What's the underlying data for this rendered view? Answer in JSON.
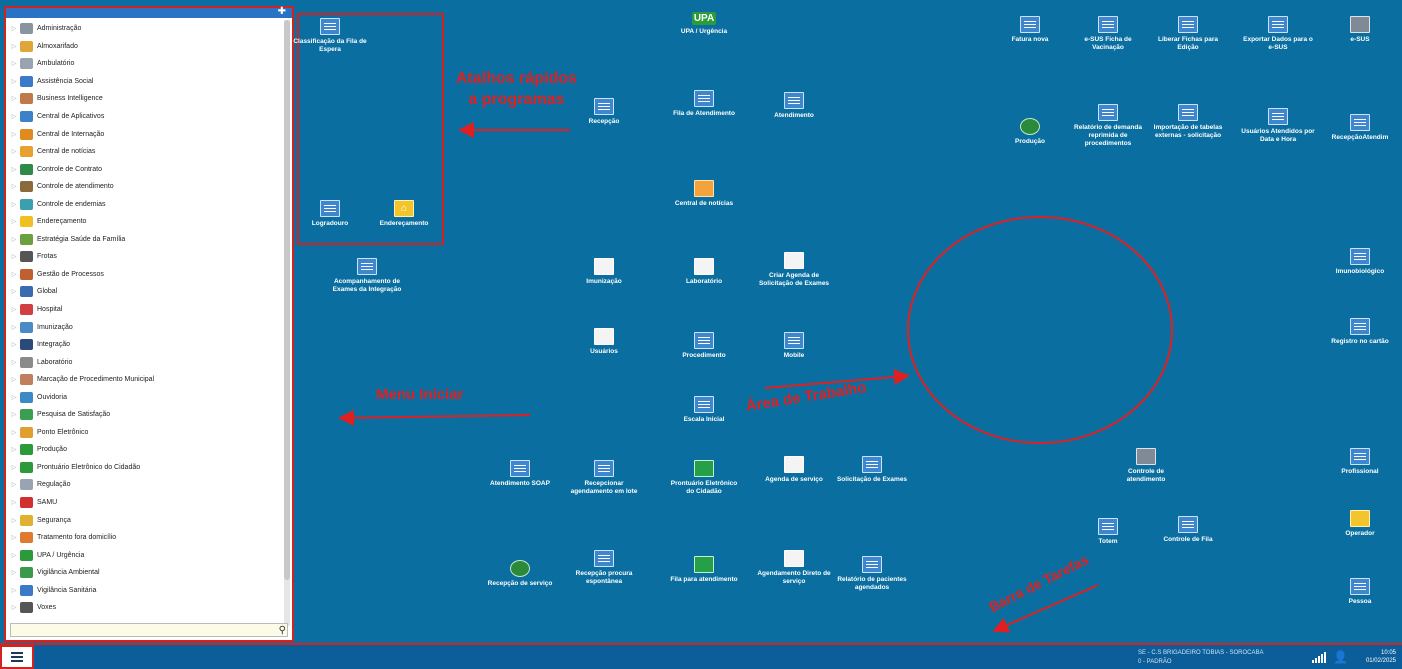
{
  "start_menu": {
    "items": [
      {
        "label": "Administração",
        "color": "#8a94a0"
      },
      {
        "label": "Almoxarifado",
        "color": "#e0a63a"
      },
      {
        "label": "Ambulatório",
        "color": "#9aa4b0"
      },
      {
        "label": "Assistência Social",
        "color": "#3b7ac8"
      },
      {
        "label": "Business Intelligence",
        "color": "#c07a4a"
      },
      {
        "label": "Central de Aplicativos",
        "color": "#3b82c8"
      },
      {
        "label": "Central de Internação",
        "color": "#e08a20"
      },
      {
        "label": "Central de notícias",
        "color": "#e8a030"
      },
      {
        "label": "Controle de Contrato",
        "color": "#2f8a4a"
      },
      {
        "label": "Controle de atendimento",
        "color": "#8a6a3a"
      },
      {
        "label": "Controle de endemias",
        "color": "#3aa0b0"
      },
      {
        "label": "Endereçamento",
        "color": "#f0c020"
      },
      {
        "label": "Estratégia Saúde da Família",
        "color": "#6aa040"
      },
      {
        "label": "Frotas",
        "color": "#555555"
      },
      {
        "label": "Gestão de Processos",
        "color": "#c06030"
      },
      {
        "label": "Global",
        "color": "#3a6ab0"
      },
      {
        "label": "Hospital",
        "color": "#d04040"
      },
      {
        "label": "Imunização",
        "color": "#4a8ac8"
      },
      {
        "label": "Integração",
        "color": "#2a4a7a"
      },
      {
        "label": "Laboratório",
        "color": "#8a8a8a"
      },
      {
        "label": "Marcação de Procedimento Municipal",
        "color": "#c08060"
      },
      {
        "label": "Ouvidoria",
        "color": "#3a8ac8"
      },
      {
        "label": "Pesquisa de Satisfação",
        "color": "#3aa050"
      },
      {
        "label": "Ponto Eletrônico",
        "color": "#e0a030"
      },
      {
        "label": "Produção",
        "color": "#2a9a3a"
      },
      {
        "label": "Prontuário Eletrônico do Cidadão",
        "color": "#2a9a3a"
      },
      {
        "label": "Regulação",
        "color": "#9aa4b0"
      },
      {
        "label": "SAMU",
        "color": "#d03030"
      },
      {
        "label": "Segurança",
        "color": "#e0b030"
      },
      {
        "label": "Tratamento fora domicílio",
        "color": "#e07a30"
      },
      {
        "label": "UPA / Urgência",
        "color": "#2a9a3a"
      },
      {
        "label": "Vigilância Ambiental",
        "color": "#3a9a4a"
      },
      {
        "label": "Vigilância Sanitária",
        "color": "#3a7ac8"
      },
      {
        "label": "Voxes",
        "color": "#555555"
      }
    ]
  },
  "quick_shortcuts": [
    {
      "label": "Classificação da Fila de Espera"
    },
    {
      "label": "Logradouro"
    },
    {
      "label": "Endereçamento"
    }
  ],
  "desktop_icons": [
    {
      "label": "UPA / Urgência"
    },
    {
      "label": "Recepção"
    },
    {
      "label": "Fila de Atendimento"
    },
    {
      "label": "Atendimento"
    },
    {
      "label": "Central de notícias"
    },
    {
      "label": "Acompanhamento de Exames da Integração"
    },
    {
      "label": "Imunização"
    },
    {
      "label": "Laboratório"
    },
    {
      "label": "Criar Agenda de Solicitação de Exames"
    },
    {
      "label": "Usuários"
    },
    {
      "label": "Procedimento"
    },
    {
      "label": "Mobile"
    },
    {
      "label": "Escala Inicial"
    },
    {
      "label": "Atendimento SOAP"
    },
    {
      "label": "Recepcionar agendamento em lote"
    },
    {
      "label": "Prontuário Eletrônico do Cidadão"
    },
    {
      "label": "Agenda de serviço"
    },
    {
      "label": "Solicitação de Exames"
    },
    {
      "label": "Recepção de serviço"
    },
    {
      "label": "Recepção procura espontânea"
    },
    {
      "label": "Fila para atendimento"
    },
    {
      "label": "Agendamento Direto de serviço"
    },
    {
      "label": "Relatório de pacientes agendados"
    },
    {
      "label": "Fatura nova"
    },
    {
      "label": "e-SUS Ficha de Vacinação"
    },
    {
      "label": "Liberar Fichas para Edição"
    },
    {
      "label": "Exportar Dados para o e-SUS"
    },
    {
      "label": "e-SUS"
    },
    {
      "label": "Produção"
    },
    {
      "label": "Relatório de demanda reprimida de procedimentos"
    },
    {
      "label": "Importação de tabelas externas - solicitação"
    },
    {
      "label": "Usuários Atendidos por Data e Hora"
    },
    {
      "label": "RecepçãoAtendim"
    },
    {
      "label": "Imunobiológico"
    },
    {
      "label": "Registro no cartão"
    },
    {
      "label": "Controle de atendimento"
    },
    {
      "label": "Totem"
    },
    {
      "label": "Controle de Fila"
    },
    {
      "label": "Profissional"
    },
    {
      "label": "Operador"
    },
    {
      "label": "Pessoa"
    }
  ],
  "annotations": {
    "atalhos_line1": "Atalhos rápidos",
    "atalhos_line2": "a programas",
    "menu": "Menu Iniciar",
    "area": "Área de Trabalho",
    "barra": "Barra de Tarefas"
  },
  "taskbar": {
    "status_line1": "SE - C.S BRIGADEIRO TOBIAS - SOROCABA",
    "status_line2": "0 - PADRÃO",
    "time": "10:05",
    "date": "01/02/2025"
  },
  "colors": {
    "desktop": "#0a6fa0",
    "annotation": "#e02020",
    "taskbar": "#0c5e9a"
  }
}
